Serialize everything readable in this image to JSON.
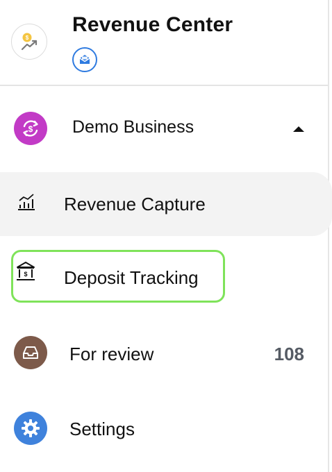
{
  "header": {
    "title": "Revenue Center",
    "logo_icon": "revenue-trend-icon",
    "badge_icon": "mail-icon",
    "badge_color": "#2f7be0"
  },
  "business": {
    "name": "Demo Business",
    "avatar_icon": "currency-exchange-icon",
    "avatar_color": "#c23bc6",
    "toggle_icon": "caret-up-icon",
    "expanded": true
  },
  "nav": {
    "items": [
      {
        "label": "Revenue Capture",
        "icon": "chart-icon",
        "selected": true
      },
      {
        "label": "Deposit Tracking",
        "icon": "bank-icon",
        "highlighted": true,
        "highlight_color": "#7fe35a"
      },
      {
        "label": "For review",
        "icon": "inbox-icon",
        "count": "108",
        "icon_color": "#7d5a4a"
      },
      {
        "label": "Settings",
        "icon": "gear-icon",
        "icon_color": "#3f82dc"
      }
    ]
  }
}
